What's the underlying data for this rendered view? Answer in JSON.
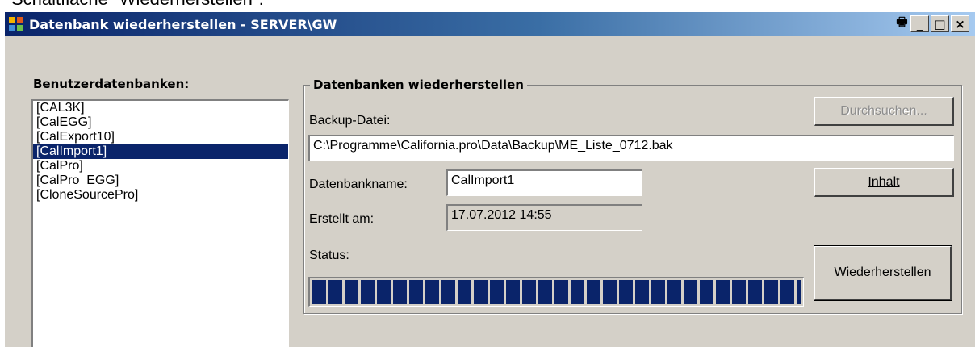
{
  "caption": "Schaltfläche \"Wiederherstellen\":",
  "window": {
    "title": "Datenbank wiederherstellen - SERVER\\GW",
    "controls": {
      "print": "🖶",
      "minimize": "_",
      "maximize": "□",
      "close": "×"
    }
  },
  "user_databases": {
    "label": "Benutzerdatenbanken:",
    "items": [
      "[CAL3K]",
      "[CalEGG]",
      "[CalExport10]",
      "[CalImport1]",
      "[CalPro]",
      "[CalPro_EGG]",
      "[CloneSourcePro]"
    ],
    "selected": "[CalImport1]"
  },
  "restore": {
    "group_title": "Datenbanken wiederherstellen",
    "backup_label": "Backup-Datei:",
    "backup_value": "C:\\Programme\\California.pro\\Data\\Backup\\ME_Liste_0712.bak",
    "browse_button": "Durchsuchen...",
    "dbname_label": "Datenbankname:",
    "dbname_value": "CalImport1",
    "content_button": "Inhalt",
    "created_label": "Erstellt am:",
    "created_value": "17.07.2012 14:55",
    "status_label": "Status:",
    "progress": 1.0,
    "restore_button": "Wiederherstellen"
  }
}
